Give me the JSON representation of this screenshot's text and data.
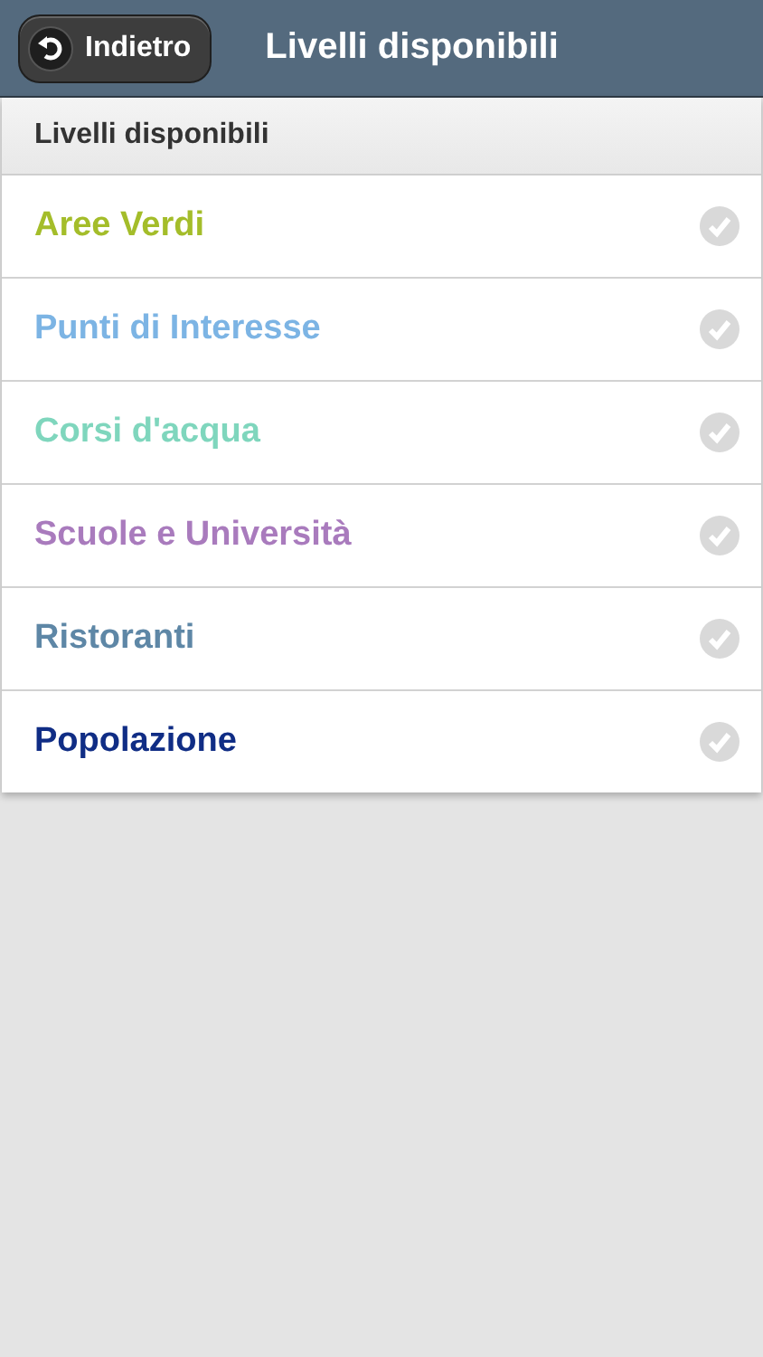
{
  "header": {
    "back_button": "Indietro",
    "title": "Livelli disponibili"
  },
  "list": {
    "divider": "Livelli disponibili",
    "items": [
      {
        "label": "Aree Verdi",
        "color": "#a4bd2a",
        "checked": false
      },
      {
        "label": "Punti di Interesse",
        "color": "#7cb4e4",
        "checked": false
      },
      {
        "label": "Corsi d'acqua",
        "color": "#7fd6bd",
        "checked": false
      },
      {
        "label": "Scuole e Università",
        "color": "#a97bbd",
        "checked": false
      },
      {
        "label": "Ristoranti",
        "color": "#5e87a6",
        "checked": false
      },
      {
        "label": "Popolazione",
        "color": "#102d85",
        "checked": false
      }
    ]
  }
}
